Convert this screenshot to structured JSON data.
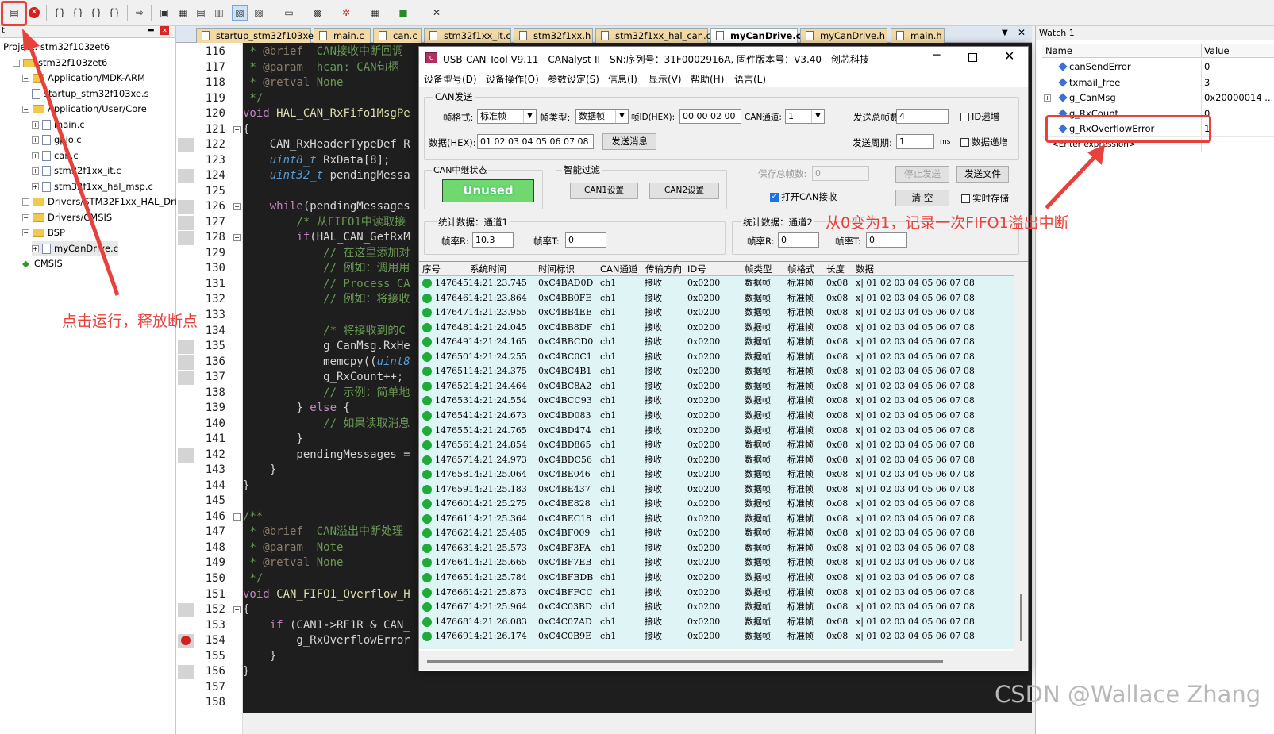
{
  "project": {
    "header": "t",
    "items": [
      {
        "label": "Project: stm32f103zet6",
        "indent": 0,
        "type": "root"
      },
      {
        "label": "stm32f103zet6",
        "indent": 1,
        "type": "target"
      },
      {
        "label": "Application/MDK-ARM",
        "indent": 2,
        "type": "folder"
      },
      {
        "label": "startup_stm32f103xe.s",
        "indent": 3,
        "type": "file"
      },
      {
        "label": "Application/User/Core",
        "indent": 2,
        "type": "folder"
      },
      {
        "label": "main.c",
        "indent": 3,
        "type": "file"
      },
      {
        "label": "gpio.c",
        "indent": 3,
        "type": "file"
      },
      {
        "label": "can.c",
        "indent": 3,
        "type": "file"
      },
      {
        "label": "stm32f1xx_it.c",
        "indent": 3,
        "type": "file"
      },
      {
        "label": "stm32f1xx_hal_msp.c",
        "indent": 3,
        "type": "file"
      },
      {
        "label": "Drivers/STM32F1xx_HAL_Driver",
        "indent": 2,
        "type": "folder"
      },
      {
        "label": "Drivers/CMSIS",
        "indent": 2,
        "type": "folder"
      },
      {
        "label": "BSP",
        "indent": 2,
        "type": "folder"
      },
      {
        "label": "myCanDrive.c",
        "indent": 3,
        "type": "file"
      },
      {
        "label": "CMSIS",
        "indent": 2,
        "type": "gem"
      }
    ]
  },
  "editor": {
    "tabs": [
      "startup_stm32f103xe.s",
      "main.c",
      "can.c",
      "stm32f1xx_it.c",
      "stm32f1xx.h",
      "stm32f1xx_hal_can.c",
      "myCanDrive.c",
      "myCanDrive.h",
      "main.h"
    ],
    "active_tab": "myCanDrive.c",
    "lines": [
      {
        "n": "116",
        "text": " * @brief  CAN接收中断回调",
        "cls": "cm"
      },
      {
        "n": "117",
        "text": " * @param  hcan: CAN句柄",
        "cls": "cm"
      },
      {
        "n": "118",
        "text": " * @retval None",
        "cls": "cm"
      },
      {
        "n": "119",
        "text": " */",
        "cls": "cm"
      },
      {
        "n": "120",
        "text": "void HAL_CAN_RxFifo1MsgPe",
        "cls": "fnline"
      },
      {
        "n": "121",
        "text": "{",
        "cls": "wt"
      },
      {
        "n": "122",
        "text": "    CAN_RxHeaderTypeDef R",
        "cls": "wt"
      },
      {
        "n": "123",
        "text": "    uint8_t RxData[8];",
        "cls": "decl"
      },
      {
        "n": "124",
        "text": "    uint32_t pendingMessa",
        "cls": "decl"
      },
      {
        "n": "125",
        "text": "",
        "cls": "wt"
      },
      {
        "n": "126",
        "text": "    while(pendingMessages",
        "cls": "kwline"
      },
      {
        "n": "127",
        "text": "        /* 从FIFO1中读取接",
        "cls": "cm"
      },
      {
        "n": "128",
        "text": "        if(HAL_CAN_GetRxM",
        "cls": "kwline"
      },
      {
        "n": "129",
        "text": "            // 在这里添加对",
        "cls": "cm"
      },
      {
        "n": "130",
        "text": "            // 例如：调用用",
        "cls": "cm"
      },
      {
        "n": "131",
        "text": "            // Process_CA",
        "cls": "cm"
      },
      {
        "n": "132",
        "text": "            // 例如：将接收",
        "cls": "cm"
      },
      {
        "n": "133",
        "text": "",
        "cls": "wt"
      },
      {
        "n": "134",
        "text": "            /* 将接收到的C",
        "cls": "cm"
      },
      {
        "n": "135",
        "text": "            g_CanMsg.RxHe",
        "cls": "wt"
      },
      {
        "n": "136",
        "text": "            memcpy((uint8",
        "cls": "memline"
      },
      {
        "n": "137",
        "text": "            g_RxCount++;",
        "cls": "wt"
      },
      {
        "n": "138",
        "text": "            // 示例：简单地",
        "cls": "cm"
      },
      {
        "n": "139",
        "text": "        } else {",
        "cls": "elseline"
      },
      {
        "n": "140",
        "text": "            // 如果读取消息",
        "cls": "cm"
      },
      {
        "n": "141",
        "text": "        }",
        "cls": "wt"
      },
      {
        "n": "142",
        "text": "        pendingMessages =",
        "cls": "wt"
      },
      {
        "n": "143",
        "text": "    }",
        "cls": "wt"
      },
      {
        "n": "144",
        "text": "}",
        "cls": "wt"
      },
      {
        "n": "145",
        "text": "",
        "cls": "wt"
      },
      {
        "n": "146",
        "text": "/**",
        "cls": "cm"
      },
      {
        "n": "147",
        "text": " * @brief  CAN溢出中断处理",
        "cls": "cm"
      },
      {
        "n": "148",
        "text": " * @param  Note",
        "cls": "cm"
      },
      {
        "n": "149",
        "text": " * @retval None",
        "cls": "cm"
      },
      {
        "n": "150",
        "text": " */",
        "cls": "cm"
      },
      {
        "n": "151",
        "text": "void CAN_FIFO1_Overflow_H",
        "cls": "fnline"
      },
      {
        "n": "152",
        "text": "{",
        "cls": "wt"
      },
      {
        "n": "153",
        "text": "    if (CAN1->RF1R & CAN_",
        "cls": "kwline"
      },
      {
        "n": "154",
        "text": "        g_RxOverflowError",
        "cls": "wt"
      },
      {
        "n": "155",
        "text": "    }",
        "cls": "wt"
      },
      {
        "n": "156",
        "text": "}",
        "cls": "wt"
      },
      {
        "n": "157",
        "text": "",
        "cls": "wt"
      },
      {
        "n": "158",
        "text": "",
        "cls": "wt"
      }
    ]
  },
  "watch": {
    "title": "Watch 1",
    "col_name": "Name",
    "col_value": "Value",
    "rows": [
      {
        "name": "canSendError",
        "value": "0",
        "expandable": false
      },
      {
        "name": "txmail_free",
        "value": "3",
        "expandable": false
      },
      {
        "name": "g_CanMsg",
        "value": "0x20000014 ...",
        "expandable": true
      },
      {
        "name": "g_RxCount",
        "value": "0",
        "expandable": false
      },
      {
        "name": "g_RxOverflowError",
        "value": "1",
        "expandable": false
      },
      {
        "name": "<Enter expression>",
        "value": "",
        "expandable": false
      }
    ]
  },
  "dialog": {
    "title": "USB-CAN Tool V9.11 - CANalyst-II - SN:序列号：31F0002916A, 固件版本号：V3.40 - 创芯科技",
    "menu": [
      "设备型号(D)",
      "设备操作(O)",
      "参数设定(S)",
      "信息(I)",
      "显示(V)",
      "帮助(H)",
      "语言(L)"
    ],
    "send": {
      "group": "CAN发送",
      "frame_format_label": "帧格式:",
      "frame_format_value": "标准帧",
      "frame_type_label": "帧类型:",
      "frame_type_value": "数据帧",
      "frame_id_label": "帧ID(HEX):",
      "frame_id_value": "00 00 02 00",
      "channel_label": "CAN通道:",
      "channel_value": "1",
      "total_label": "发送总帧数:",
      "total_value": "4",
      "id_inc_label": "ID递增",
      "data_label": "数据(HEX):",
      "data_value": "01 02 03 04 05 06 07 08",
      "send_btn": "发送消息",
      "period_label": "发送周期:",
      "period_value": "1",
      "period_unit": "ms",
      "data_inc_label": "数据递增"
    },
    "relay": {
      "group": "CAN中继状态",
      "status": "Unused"
    },
    "filter": {
      "group": "智能过滤",
      "can1": "CAN1设置",
      "can2": "CAN2设置"
    },
    "save_total_label": "保存总帧数:",
    "save_total_value": "0",
    "stop_send": "停止发送",
    "send_file": "发送文件",
    "open_recv": "打开CAN接收",
    "clear": "清 空",
    "realtime_save": "实时存储",
    "stats1": {
      "title": "统计数据：通道1",
      "rx_label": "帧率R:",
      "rx_value": "10.3",
      "tx_label": "帧率T:",
      "tx_value": "0"
    },
    "stats2": {
      "title": "统计数据：通道2",
      "rx_label": "帧率R:",
      "rx_value": "0",
      "tx_label": "帧率T:",
      "tx_value": "0"
    },
    "table": {
      "columns": [
        "序号",
        "系统时间",
        "时间标识",
        "CAN通道",
        "传输方向",
        "ID号",
        "帧类型",
        "帧格式",
        "长度",
        "数据"
      ],
      "channel": "ch1",
      "direction": "接收",
      "id": "0x0200",
      "frame_type": "数据帧",
      "frame_format": "标准帧",
      "length": "0x08",
      "data": "x| 01 02 03 04 05 06 07 08",
      "rows": [
        [
          "147645",
          "14:21:23.745",
          "0xC4BAD0D"
        ],
        [
          "147646",
          "14:21:23.864",
          "0xC4BB0FE"
        ],
        [
          "147647",
          "14:21:23.955",
          "0xC4BB4EE"
        ],
        [
          "147648",
          "14:21:24.045",
          "0xC4BB8DF"
        ],
        [
          "147649",
          "14:21:24.165",
          "0xC4BBCD0"
        ],
        [
          "147650",
          "14:21:24.255",
          "0xC4BC0C1"
        ],
        [
          "147651",
          "14:21:24.375",
          "0xC4BC4B1"
        ],
        [
          "147652",
          "14:21:24.464",
          "0xC4BC8A2"
        ],
        [
          "147653",
          "14:21:24.554",
          "0xC4BCC93"
        ],
        [
          "147654",
          "14:21:24.673",
          "0xC4BD083"
        ],
        [
          "147655",
          "14:21:24.765",
          "0xC4BD474"
        ],
        [
          "147656",
          "14:21:24.854",
          "0xC4BD865"
        ],
        [
          "147657",
          "14:21:24.973",
          "0xC4BDC56"
        ],
        [
          "147658",
          "14:21:25.064",
          "0xC4BE046"
        ],
        [
          "147659",
          "14:21:25.183",
          "0xC4BE437"
        ],
        [
          "147660",
          "14:21:25.275",
          "0xC4BE828"
        ],
        [
          "147661",
          "14:21:25.364",
          "0xC4BEC18"
        ],
        [
          "147662",
          "14:21:25.485",
          "0xC4BF009"
        ],
        [
          "147663",
          "14:21:25.573",
          "0xC4BF3FA"
        ],
        [
          "147664",
          "14:21:25.665",
          "0xC4BF7EB"
        ],
        [
          "147665",
          "14:21:25.784",
          "0xC4BFBDB"
        ],
        [
          "147666",
          "14:21:25.873",
          "0xC4BFFCC"
        ],
        [
          "147667",
          "14:21:25.964",
          "0xC4C03BD"
        ],
        [
          "147668",
          "14:21:26.083",
          "0xC4C07AD"
        ],
        [
          "147669",
          "14:21:26.174",
          "0xC4C0B9E"
        ]
      ]
    }
  },
  "annotations": {
    "left": "点击运行，释放断点",
    "right": "从0变为1，记录一次FIFO1溢出中断",
    "color": "#e8413c"
  },
  "watermark": "CSDN @Wallace Zhang"
}
